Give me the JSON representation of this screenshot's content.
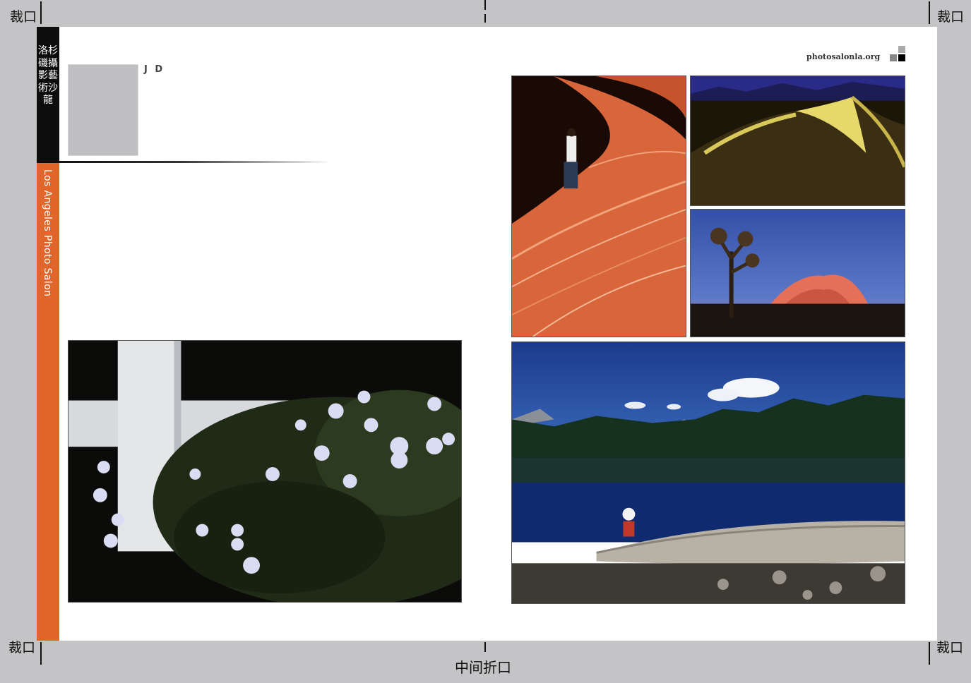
{
  "crop_marks": {
    "top_left": "裁口",
    "top_right": "裁口",
    "bottom_left": "裁口",
    "bottom_right": "裁口",
    "fold": "中间折口"
  },
  "spine": {
    "chinese_title": "洛杉磯攝影藝術沙龍",
    "english_title": "Los Angeles Photo Salon",
    "colors": {
      "top_band": "#0d0d0d",
      "bottom_band": "#e0662c"
    }
  },
  "author": {
    "name": "J D"
  },
  "header": {
    "site_url": "photosalonla.org"
  }
}
